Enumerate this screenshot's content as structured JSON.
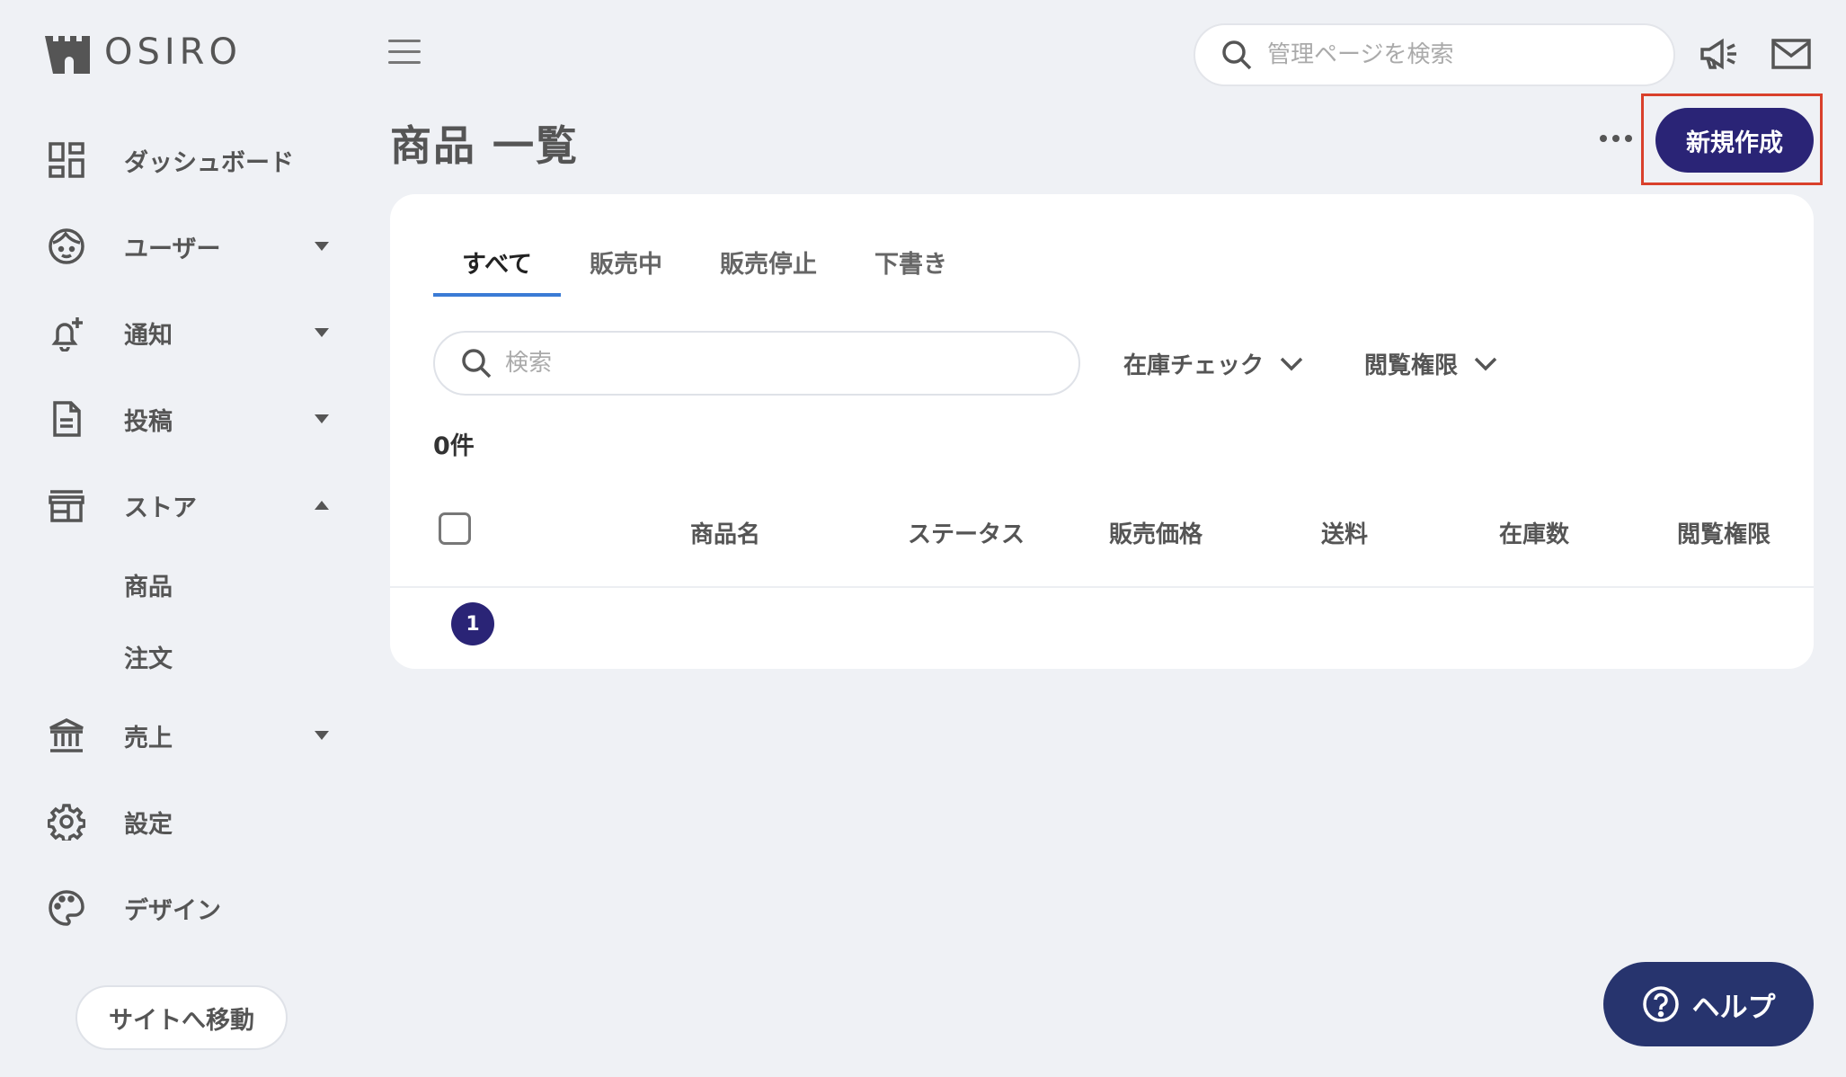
{
  "brand": {
    "name": "OSIRO"
  },
  "sidebar": {
    "items": [
      {
        "label": "ダッシュボード",
        "icon": "dashboard-icon",
        "caret": ""
      },
      {
        "label": "ユーザー",
        "icon": "user-face-icon",
        "caret": "down"
      },
      {
        "label": "通知",
        "icon": "bell-plus-icon",
        "caret": "down"
      },
      {
        "label": "投稿",
        "icon": "document-icon",
        "caret": "down"
      },
      {
        "label": "ストア",
        "icon": "store-icon",
        "caret": "up"
      }
    ],
    "store_sub": [
      {
        "label": "商品",
        "active": true
      },
      {
        "label": "注文",
        "active": false
      }
    ],
    "items_after": [
      {
        "label": "売上",
        "icon": "bank-icon",
        "caret": "down"
      },
      {
        "label": "設定",
        "icon": "gear-icon",
        "caret": ""
      },
      {
        "label": "デザイン",
        "icon": "palette-icon",
        "caret": ""
      }
    ],
    "site_button": "サイトへ移動"
  },
  "topbar": {
    "search_placeholder": "管理ページを検索",
    "icons": [
      "megaphone-icon",
      "mail-icon"
    ]
  },
  "page": {
    "title": "商品 一覧",
    "new_button": "新規作成"
  },
  "card": {
    "tabs": [
      {
        "label": "すべて",
        "active": true
      },
      {
        "label": "販売中",
        "active": false
      },
      {
        "label": "販売停止",
        "active": false
      },
      {
        "label": "下書き",
        "active": false
      }
    ],
    "search_placeholder": "検索",
    "filters": [
      "在庫チェック",
      "閲覧権限"
    ],
    "count": "0件",
    "columns": [
      "商品名",
      "ステータス",
      "販売価格",
      "送料",
      "在庫数",
      "閲覧権限"
    ],
    "pagination": {
      "current": "1"
    }
  },
  "help": {
    "label": "ヘルプ"
  },
  "colors": {
    "primary": "#2a2476",
    "help": "#27346e",
    "tab_underline": "#3a7bd5",
    "highlight": "#d9402b",
    "background": "#eff1f5"
  }
}
